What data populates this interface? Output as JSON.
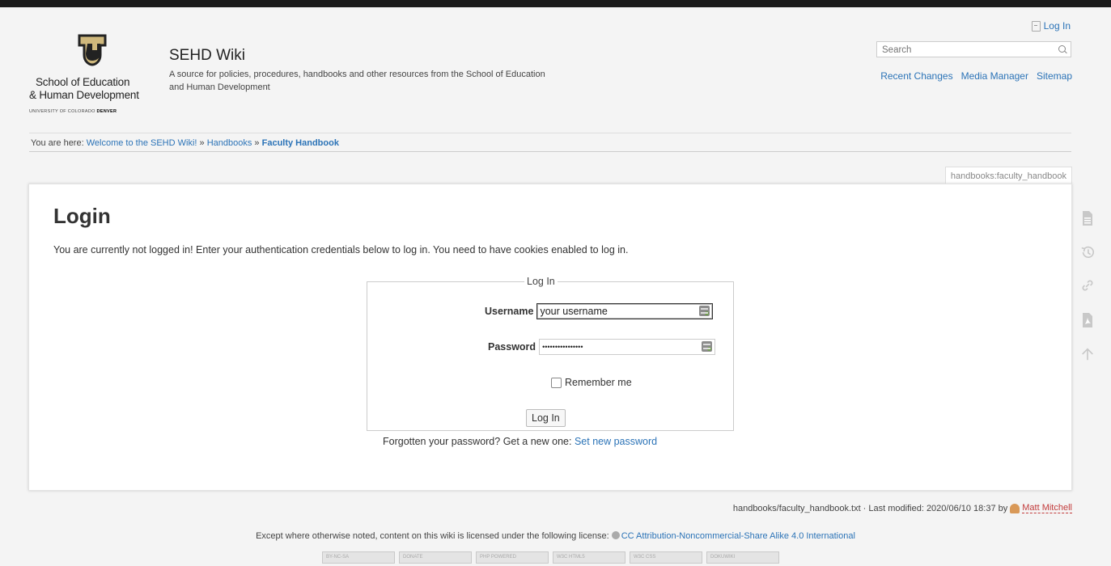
{
  "branding": {
    "line1": "School of Education",
    "line2": "& Human Development",
    "line3_prefix": "UNIVERSITY OF COLORADO ",
    "line3_bold": "DENVER"
  },
  "site": {
    "title": "SEHD Wiki",
    "description": "A source for policies, procedures, handbooks and other resources from the School of Education and Human Development"
  },
  "user_tools": {
    "login": "Log In"
  },
  "search": {
    "placeholder": "Search"
  },
  "site_tools": [
    "Recent Changes",
    "Media Manager",
    "Sitemap"
  ],
  "breadcrumb": {
    "prefix": "You are here:",
    "items": [
      "Welcome to the SEHD Wiki!",
      "Handbooks",
      "Faculty Handbook"
    ],
    "separator": "»"
  },
  "page_id": "handbooks:faculty_handbook",
  "content": {
    "heading": "Login",
    "intro": "You are currently not logged in! Enter your authentication credentials below to log in. You need to have cookies enabled to log in."
  },
  "login_form": {
    "legend": "Log In",
    "username_label": "Username",
    "username_value": "your username",
    "password_label": "Password",
    "password_value": "••••••••••••••••",
    "remember_label": "Remember me",
    "submit_label": "Log In",
    "forgot_text": "Forgotten your password? Get a new one:",
    "forgot_link": "Set new password"
  },
  "page_tools_icons": [
    "show-page-icon",
    "old-revisions-icon",
    "backlinks-icon",
    "export-pdf-icon",
    "back-to-top-icon"
  ],
  "doc_info": {
    "text": "handbooks/faculty_handbook.txt · Last modified: 2020/06/10 18:37 by",
    "user": "Matt Mitchell"
  },
  "license": {
    "text": "Except where otherwise noted, content on this wiki is licensed under the following license:",
    "link": "CC Attribution-Noncommercial-Share Alike 4.0 International"
  },
  "badges": [
    "BY-NC-SA",
    "DONATE",
    "PHP POWERED",
    "W3C HTML5",
    "W3C CSS",
    "DOKUWIKI"
  ],
  "colors": {
    "link": "#2b73b7",
    "user_link": "#c23b3b",
    "cu_gold": "#cfb87c"
  }
}
